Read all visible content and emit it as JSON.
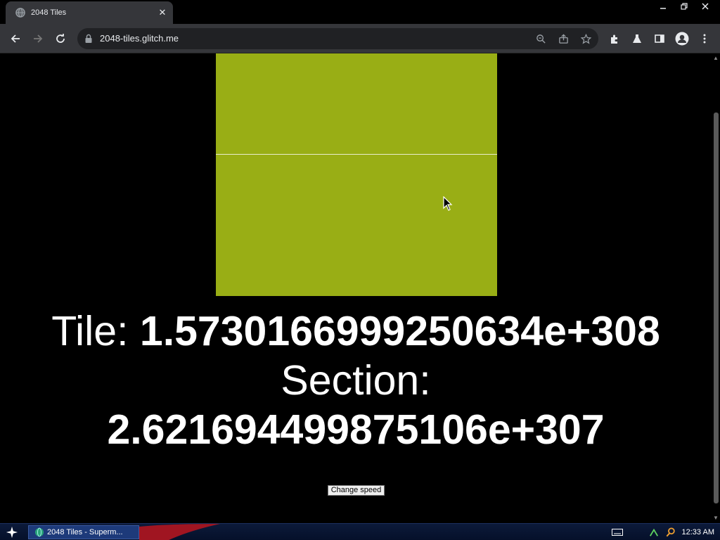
{
  "browser": {
    "tab_title": "2048 Tiles",
    "url": "2048-tiles.glitch.me"
  },
  "page": {
    "tile_label": "Tile: ",
    "tile_value": "1.5730166999250634e+308",
    "section_label": "Section:",
    "section_value": "2.621694499875106e+307",
    "change_speed_label": "Change speed",
    "tile_color": "#99ae15"
  },
  "taskbar": {
    "task_label": "2048 Tiles - Superm...",
    "clock": "12:33 AM"
  },
  "icons": [
    "globe-icon",
    "close-icon",
    "minimize-icon",
    "restore-icon",
    "back-icon",
    "forward-icon",
    "reload-icon",
    "lock-icon",
    "zoom-icon",
    "share-icon",
    "star-icon",
    "extensions-icon",
    "labs-icon",
    "side-panel-icon",
    "profile-icon",
    "menu-icon",
    "cursor-icon",
    "start-icon",
    "keyboard-icon",
    "search-icon"
  ]
}
